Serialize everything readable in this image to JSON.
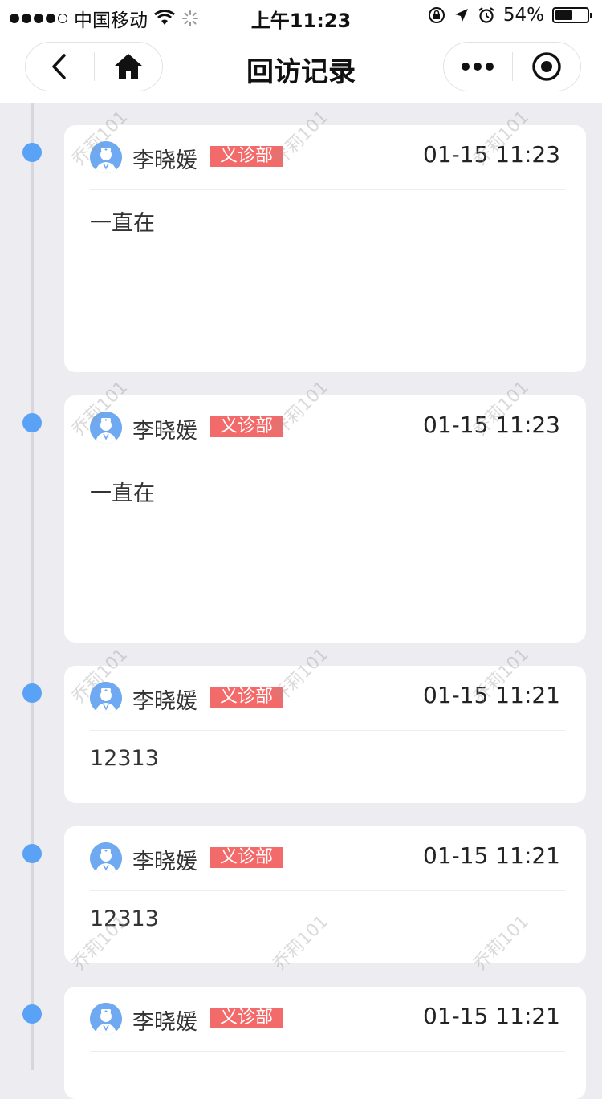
{
  "status_bar": {
    "carrier": "中国移动",
    "time": "上午11:23",
    "battery_text": "54%",
    "battery_level": 0.54
  },
  "nav": {
    "title": "回访记录",
    "back_icon": "chevron-left-icon",
    "home_icon": "home-icon",
    "more_icon": "more-dots-icon",
    "close_icon": "target-circle-icon"
  },
  "colors": {
    "accent": "#5aa2f6",
    "dept_badge": "#f36a6a",
    "background": "#ececf1"
  },
  "records": [
    {
      "name": "李晓媛",
      "dept": "义诊部",
      "time": "01-15 11:23",
      "content": "一直在"
    },
    {
      "name": "李晓媛",
      "dept": "义诊部",
      "time": "01-15 11:23",
      "content": "一直在"
    },
    {
      "name": "李晓媛",
      "dept": "义诊部",
      "time": "01-15 11:21",
      "content": "12313"
    },
    {
      "name": "李晓媛",
      "dept": "义诊部",
      "time": "01-15 11:21",
      "content": "12313"
    },
    {
      "name": "李晓媛",
      "dept": "义诊部",
      "time": "01-15 11:21",
      "content": ""
    }
  ],
  "watermark": "乔莉101"
}
